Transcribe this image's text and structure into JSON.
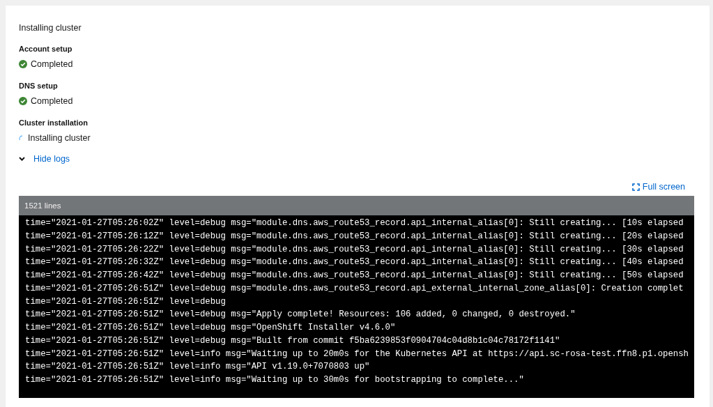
{
  "title": "Installing cluster",
  "steps": [
    {
      "heading": "Account setup",
      "status": "Completed",
      "kind": "completed"
    },
    {
      "heading": "DNS setup",
      "status": "Completed",
      "kind": "completed"
    },
    {
      "heading": "Cluster installation",
      "status": "Installing cluster",
      "kind": "in-progress"
    }
  ],
  "logs_toggle": {
    "label": "Hide logs",
    "expanded": true
  },
  "full_screen": "Full screen",
  "log_viewer": {
    "line_count": "1521 lines",
    "lines": [
      "time=\"2021-01-27T05:26:02Z\" level=debug msg=\"module.dns.aws_route53_record.api_internal_alias[0]: Still creating... [10s elapsed",
      "time=\"2021-01-27T05:26:12Z\" level=debug msg=\"module.dns.aws_route53_record.api_internal_alias[0]: Still creating... [20s elapsed",
      "time=\"2021-01-27T05:26:22Z\" level=debug msg=\"module.dns.aws_route53_record.api_internal_alias[0]: Still creating... [30s elapsed",
      "time=\"2021-01-27T05:26:32Z\" level=debug msg=\"module.dns.aws_route53_record.api_internal_alias[0]: Still creating... [40s elapsed",
      "time=\"2021-01-27T05:26:42Z\" level=debug msg=\"module.dns.aws_route53_record.api_internal_alias[0]: Still creating... [50s elapsed",
      "time=\"2021-01-27T05:26:51Z\" level=debug msg=\"module.dns.aws_route53_record.api_external_internal_zone_alias[0]: Creation complet",
      "time=\"2021-01-27T05:26:51Z\" level=debug",
      "time=\"2021-01-27T05:26:51Z\" level=debug msg=\"Apply complete! Resources: 106 added, 0 changed, 0 destroyed.\"",
      "time=\"2021-01-27T05:26:51Z\" level=debug msg=\"OpenShift Installer v4.6.0\"",
      "time=\"2021-01-27T05:26:51Z\" level=debug msg=\"Built from commit f5ba6239853f0904704c04d8b1c04c78172f1141\"",
      "time=\"2021-01-27T05:26:51Z\" level=info msg=\"Waiting up to 20m0s for the Kubernetes API at https://api.sc-rosa-test.ffn8.p1.opensh",
      "time=\"2021-01-27T05:26:51Z\" level=info msg=\"API v1.19.0+7070803 up\"",
      "time=\"2021-01-27T05:26:51Z\" level=info msg=\"Waiting up to 30m0s for bootstrapping to complete...\""
    ]
  }
}
